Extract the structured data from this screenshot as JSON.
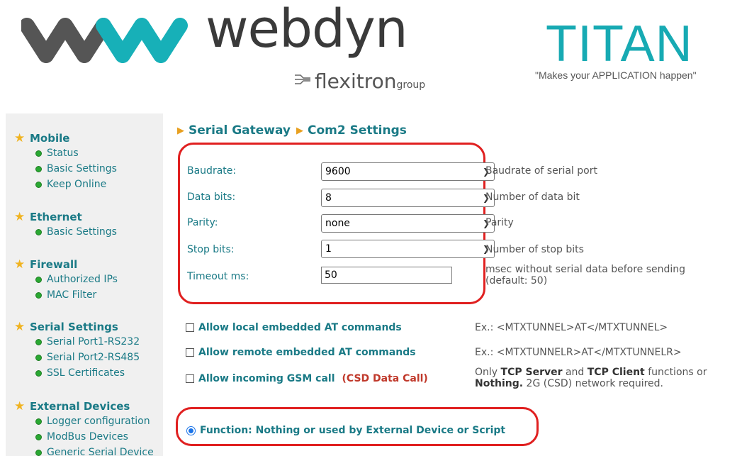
{
  "header": {
    "brand": "webdyn",
    "group_big": "flexitron",
    "group_small": "group",
    "product": "TITAN",
    "tagline": "\"Makes your APPLICATION happen\""
  },
  "sidebar": {
    "sections": [
      {
        "title": "Mobile",
        "items": [
          "Status",
          "Basic Settings",
          "Keep Online"
        ]
      },
      {
        "title": "Ethernet",
        "items": [
          "Basic Settings"
        ]
      },
      {
        "title": "Firewall",
        "items": [
          "Authorized IPs",
          "MAC Filter"
        ]
      },
      {
        "title": "Serial Settings",
        "items": [
          "Serial Port1-RS232",
          "Serial Port2-RS485",
          "SSL Certificates"
        ]
      },
      {
        "title": "External Devices",
        "items": [
          "Logger configuration",
          "ModBus Devices",
          "Generic Serial Device"
        ]
      }
    ]
  },
  "breadcrumb": {
    "part1": "Serial Gateway",
    "part2": "Com2 Settings"
  },
  "form": {
    "baudrate": {
      "label": "Baudrate:",
      "value": "9600",
      "desc": "Baudrate of serial port"
    },
    "databits": {
      "label": "Data bits:",
      "value": "8",
      "desc": "Number of data bit"
    },
    "parity": {
      "label": "Parity:",
      "value": "none",
      "desc": "Parity"
    },
    "stopbits": {
      "label": "Stop bits:",
      "value": "1",
      "desc": "Number of stop bits"
    },
    "timeout": {
      "label": "Timeout ms:",
      "value": "50",
      "desc1": "msec without serial data before sending",
      "desc2": "(default: 50)"
    }
  },
  "options": {
    "local_at": {
      "label": "Allow local embedded AT commands",
      "example": "Ex.:  <MTXTUNNEL>AT</MTXTUNNEL>",
      "checked": false
    },
    "remote_at": {
      "label": "Allow remote embedded AT commands",
      "example": "Ex.: <MTXTUNNELR>AT</MTXTUNNELR>",
      "checked": false
    },
    "gsm_call": {
      "label": "Allow incoming GSM call",
      "note": "(CSD Data Call)",
      "checked": false,
      "info_1": "Only ",
      "info_tcp_server": "TCP Server",
      "info_2": " and ",
      "info_tcp_client": "TCP Client",
      "info_3": " functions or",
      "info_nothing": "Nothing.",
      "info_4": " 2G (CSD) network required."
    }
  },
  "function": {
    "label": "Function:  Nothing or used by External Device or Script",
    "selected": true
  },
  "colors": {
    "accent": "#1a7a86",
    "highlight": "#e02020",
    "titan": "#17aab3",
    "star": "#f0b320"
  },
  "icons": [
    "logo-wave-icon",
    "flexitron-icon",
    "star-icon",
    "bullet-icon",
    "chevron-down-icon",
    "triangle-right-icon"
  ]
}
